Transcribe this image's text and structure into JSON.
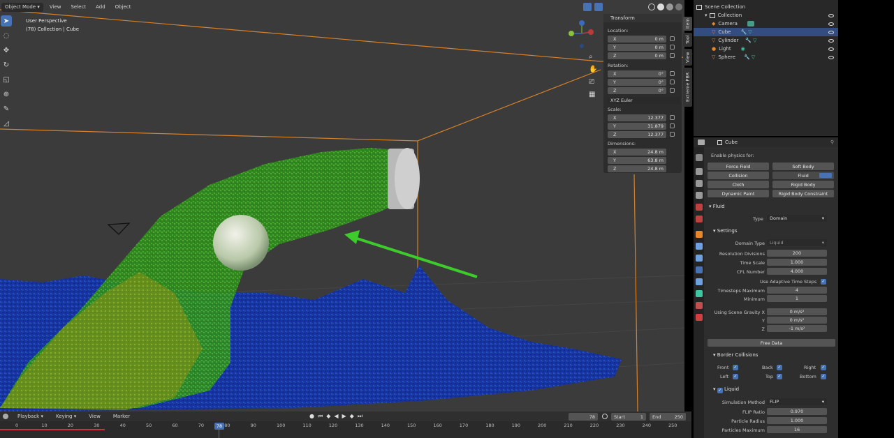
{
  "header": {
    "mode": "Object Mode",
    "menus": [
      "View",
      "Select",
      "Add",
      "Object"
    ]
  },
  "viewport": {
    "info_line1": "User Perspective",
    "info_line2": "(78) Collection | Cube"
  },
  "npanel": {
    "title": "Transform",
    "location_label": "Location:",
    "location": [
      {
        "axis": "X",
        "value": "0 m"
      },
      {
        "axis": "Y",
        "value": "0 m"
      },
      {
        "axis": "Z",
        "value": "0 m"
      }
    ],
    "rotation_label": "Rotation:",
    "rotation": [
      {
        "axis": "X",
        "value": "0°"
      },
      {
        "axis": "Y",
        "value": "0°"
      },
      {
        "axis": "Z",
        "value": "0°"
      }
    ],
    "rotation_mode": "XYZ Euler",
    "scale_label": "Scale:",
    "scale": [
      {
        "axis": "X",
        "value": "12.377"
      },
      {
        "axis": "Y",
        "value": "31.879"
      },
      {
        "axis": "Z",
        "value": "12.377"
      }
    ],
    "dimensions_label": "Dimensions:",
    "dimensions": [
      {
        "axis": "X",
        "value": "24.8 m"
      },
      {
        "axis": "Y",
        "value": "63.8 m"
      },
      {
        "axis": "Z",
        "value": "24.8 m"
      }
    ],
    "tabs": [
      "Item",
      "Tool",
      "View",
      "Extreme PBR"
    ]
  },
  "outliner": {
    "root": "Scene Collection",
    "collection": "Collection",
    "items": [
      "Camera",
      "Cube",
      "Cylinder",
      "Light",
      "Sphere"
    ],
    "selected": "Cube"
  },
  "properties": {
    "object_name": "Cube",
    "enable_label": "Enable physics for:",
    "physics_buttons": [
      [
        "Force Field",
        "Soft Body"
      ],
      [
        "Collision",
        "Fluid"
      ],
      [
        "Cloth",
        "Rigid Body"
      ],
      [
        "Dynamic Paint",
        "Rigid Body Constraint"
      ]
    ],
    "fluid_header": "Fluid",
    "type_label": "Type",
    "type_value": "Domain",
    "settings_header": "Settings",
    "domain_type_label": "Domain Type",
    "domain_type_value": "Liquid",
    "fields": [
      {
        "label": "Resolution Divisions",
        "value": "200"
      },
      {
        "label": "Time Scale",
        "value": "1.000"
      },
      {
        "label": "CFL Number",
        "value": "4.000"
      }
    ],
    "adaptive_label": "Use Adaptive Time Steps",
    "timestep_fields": [
      {
        "label": "Timesteps Maximum",
        "value": "4"
      },
      {
        "label": "Minimum",
        "value": "1"
      }
    ],
    "gravity": [
      {
        "label": "Using Scene Gravity X",
        "value": "0 m/s²"
      },
      {
        "label": "Y",
        "value": "0 m/s²"
      },
      {
        "label": "Z",
        "value": "-1 m/s²"
      }
    ],
    "free_data": "Free Data",
    "border_header": "Border Collisions",
    "borders": [
      [
        "Front",
        "Back",
        "Right"
      ],
      [
        "Left",
        "Top",
        "Bottom"
      ]
    ],
    "liquid_header": "Liquid",
    "sim_method_label": "Simulation Method",
    "sim_method_value": "FLIP",
    "liquid_fields": [
      {
        "label": "FLIP Ratio",
        "value": "0.970"
      },
      {
        "label": "Particle Radius",
        "value": "1.000"
      },
      {
        "label": "Particles Maximum",
        "value": "16"
      }
    ]
  },
  "timeline": {
    "menus": [
      "Playback",
      "Keying",
      "View",
      "Marker"
    ],
    "current_frame": "78",
    "start_label": "Start",
    "start_value": "1",
    "end_label": "End",
    "end_value": "250",
    "ticks": [
      "0",
      "10",
      "20",
      "30",
      "40",
      "50",
      "60",
      "70",
      "80",
      "90",
      "100",
      "110",
      "120",
      "130",
      "140",
      "150",
      "160",
      "170",
      "180",
      "190",
      "200",
      "210",
      "220",
      "230",
      "240",
      "250"
    ],
    "playhead_label": "78"
  },
  "colors": {
    "accent": "#4772b3",
    "orange": "#e8872a",
    "particles_green": "#3fc41e",
    "particles_blue": "#1b3cc7"
  }
}
